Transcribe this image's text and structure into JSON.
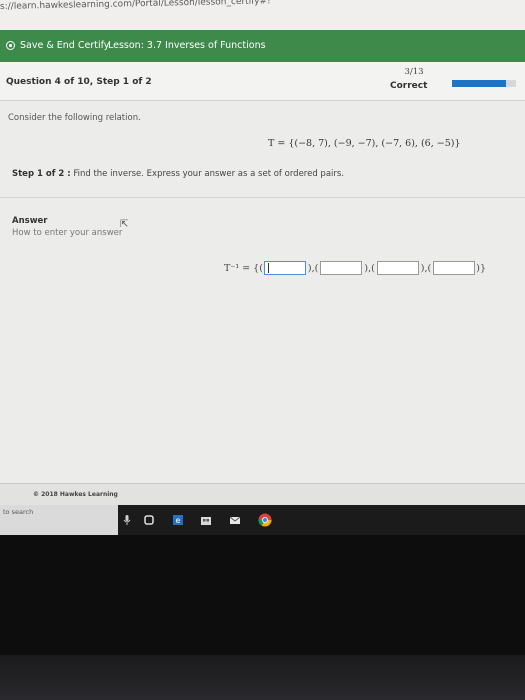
{
  "browser": {
    "url": "s://learn.hawkeslearning.com/Portal/Lesson/lesson_certify#!"
  },
  "nav": {
    "save_label": "Save & End Certify",
    "lesson_label": "Lesson: 3.7 Inverses of Functions"
  },
  "question": {
    "title": "Question 4 of 10, Step 1 of 2",
    "score": "3/13",
    "status": "Correct",
    "progress_fraction": 0.85
  },
  "content": {
    "prompt": "Consider the following relation.",
    "relation": "T = {(−8, 7), (−9, −7), (−7, 6), (6, −5)}",
    "step_label": "Step 1 of 2 :",
    "step_text": "Find the inverse. Express your answer as a set of ordered pairs.",
    "answer_label": "Answer",
    "howto": "How to enter your answer",
    "inverse_prefix": "T⁻¹ = {(",
    "pair_sep": "),(",
    "suffix": ")}",
    "inputs": [
      {
        "value": "",
        "placeholder": ""
      },
      {
        "value": "",
        "placeholder": ""
      },
      {
        "value": "",
        "placeholder": "·"
      },
      {
        "value": "",
        "placeholder": ""
      }
    ]
  },
  "footer": {
    "copyright": "© 2018 Hawkes Learning"
  },
  "taskbar": {
    "search_text": "to search"
  },
  "colors": {
    "nav_green": "#3d8a4a",
    "progress_blue": "#1e73c6"
  }
}
